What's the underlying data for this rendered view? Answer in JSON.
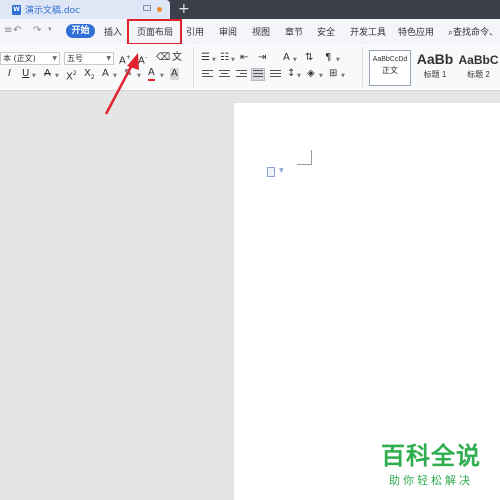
{
  "window": {
    "doc_name": "演示文稿.doc",
    "new_tab": "+"
  },
  "menu": {
    "start": "开始",
    "items": [
      "插入",
      "页面布局",
      "引用",
      "审阅",
      "视图",
      "章节",
      "安全",
      "开发工具",
      "特色应用"
    ],
    "search": "查找命令、"
  },
  "toolbar": {
    "font_name": "本 (正文)",
    "font_size": "五号",
    "styles": [
      {
        "sample": "AaBbCcDd",
        "name": "正文"
      },
      {
        "sample": "AaBb",
        "name": "标题 1"
      },
      {
        "sample": "AaBbC",
        "name": "标题 2"
      }
    ]
  },
  "watermark": {
    "title": "百科全说",
    "subtitle": "助你轻松解决"
  },
  "colors": {
    "accent": "#2f6fd6",
    "highlight": "#e0232e",
    "watermark": "#2eae4e"
  }
}
